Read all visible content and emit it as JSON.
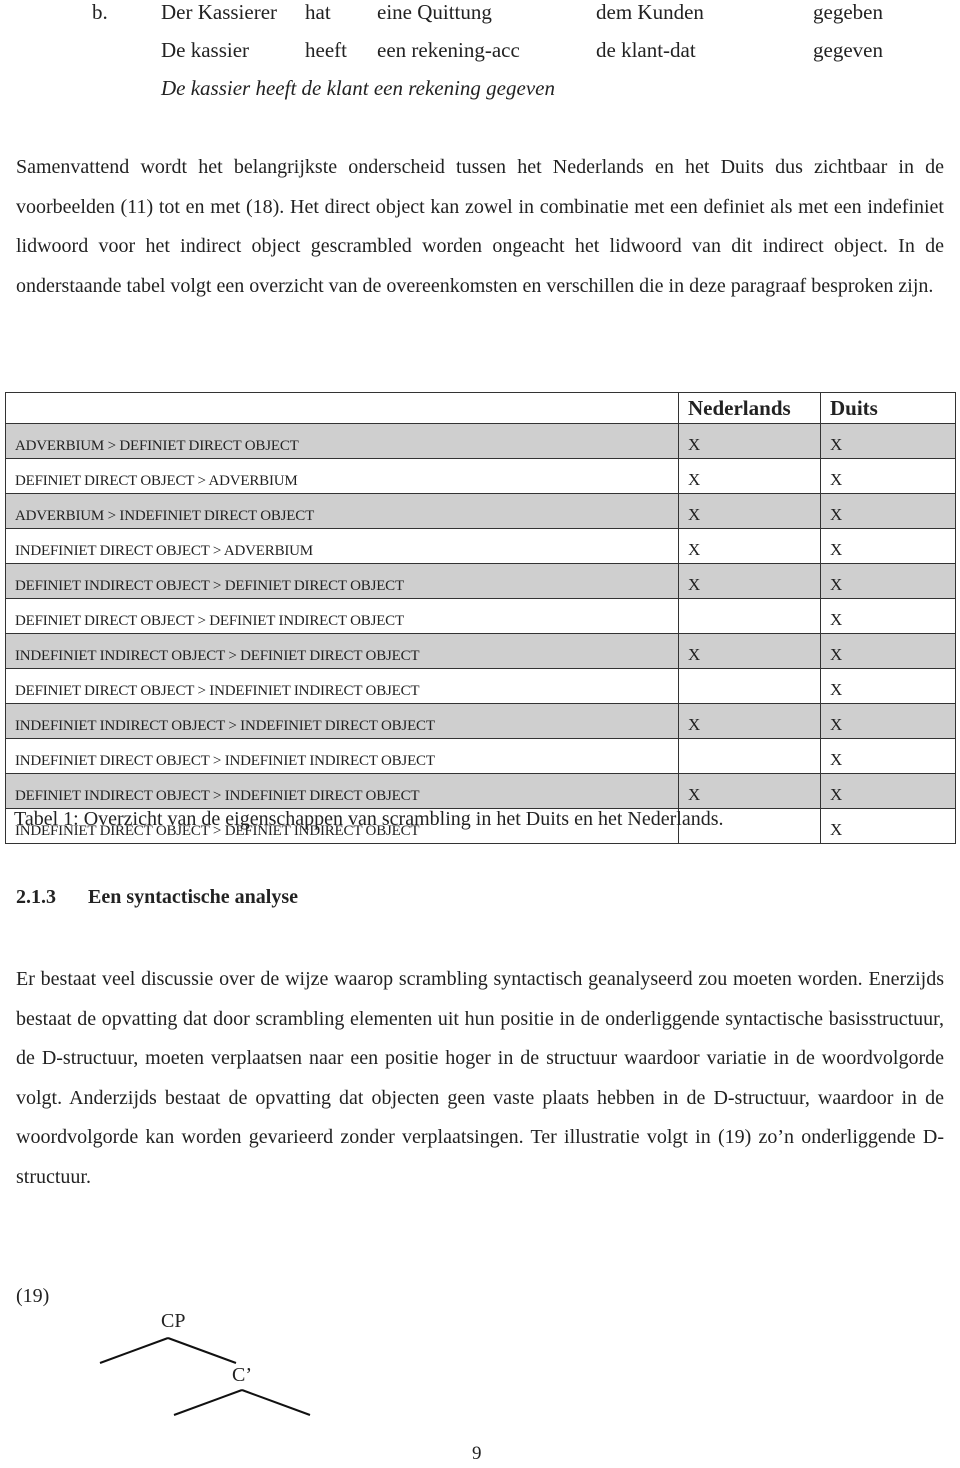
{
  "example_b": {
    "marker": "b.",
    "german": [
      "Der Kassierer",
      "hat",
      "eine Quittung",
      "dem Kunden",
      "gegeben"
    ],
    "dutch_gloss": [
      "De kassier",
      "heeft",
      "een rekening-acc",
      "de klant-dat",
      "gegeven"
    ],
    "translation": "De kassier heeft de klant een rekening gegeven"
  },
  "paragraph1": "Samenvattend wordt het belangrijkste onderscheid tussen het Nederlands en het Duits dus zichtbaar in de voorbeelden (11) tot en met (18). Het direct object kan zowel in combinatie met een definiet als met een indefiniet lidwoord voor het indirect object gescrambled worden ongeacht het lidwoord van dit indirect object. In de onderstaande tabel volgt een overzicht van de overeenkomsten en verschillen die in deze paragraaf besproken zijn.",
  "table": {
    "headers": [
      "",
      "Nederlands",
      "Duits"
    ],
    "rows": [
      {
        "label": "ADVERBIUM > DEFINIET DIRECT OBJECT",
        "nederlands": "X",
        "duits": "X"
      },
      {
        "label": "DEFINIET DIRECT OBJECT > ADVERBIUM",
        "nederlands": "X",
        "duits": "X"
      },
      {
        "label": "ADVERBIUM >  INDEFINIET DIRECT OBJECT",
        "nederlands": "X",
        "duits": "X"
      },
      {
        "label": "INDEFINIET DIRECT OBJECT > ADVERBIUM",
        "nederlands": "X",
        "duits": "X"
      },
      {
        "label": "DEFINIET INDIRECT OBJECT > DEFINIET DIRECT OBJECT",
        "nederlands": "X",
        "duits": "X"
      },
      {
        "label": "DEFINIET DIRECT OBJECT > DEFINIET INDIRECT OBJECT",
        "nederlands": "",
        "duits": "X"
      },
      {
        "label": "INDEFINIET INDIRECT OBJECT > DEFINIET DIRECT OBJECT",
        "nederlands": "X",
        "duits": "X"
      },
      {
        "label": "DEFINIET DIRECT OBJECT > INDEFINIET INDIRECT OBJECT",
        "nederlands": "",
        "duits": "X"
      },
      {
        "label": "INDEFINIET INDIRECT OBJECT > INDEFINIET DIRECT OBJECT",
        "nederlands": "X",
        "duits": "X"
      },
      {
        "label": "INDEFINIET DIRECT OBJECT > INDEFINIET INDIRECT OBJECT",
        "nederlands": "",
        "duits": "X"
      },
      {
        "label": "DEFINIET INDIRECT OBJECT > INDEFINIET DIRECT OBJECT",
        "nederlands": "X",
        "duits": "X"
      },
      {
        "label": "INDEFINIET DIRECT OBJECT > DEFINIET INDIRECT OBJECT",
        "nederlands": "",
        "duits": "X"
      }
    ],
    "shaded_row_color": "#cfcfcf",
    "caption": "Tabel 1: Overzicht van de eigenschappen van scrambling in het Duits en het Nederlands."
  },
  "section": {
    "number": "2.1.3",
    "title": "Een syntactische analyse"
  },
  "paragraph2": "Er bestaat veel discussie over de wijze waarop scrambling syntactisch geanalyseerd zou moeten worden. Enerzijds bestaat de opvatting dat door scrambling elementen uit hun positie in de onderliggende syntactische basisstructuur, de D-structuur, moeten verplaatsen naar een positie hoger in de structuur waardoor variatie in de woordvolgorde volgt. Anderzijds bestaat de opvatting dat objecten geen vaste plaats hebben in de D-structuur, waardoor in de woordvolgorde kan worden gevarieerd zonder verplaatsingen. Ter illustratie volgt in (19) zo’n onderliggende D-structuur.",
  "example19": {
    "marker": "(19)",
    "nodes": [
      "CP",
      "C’"
    ]
  },
  "page_number": "9"
}
